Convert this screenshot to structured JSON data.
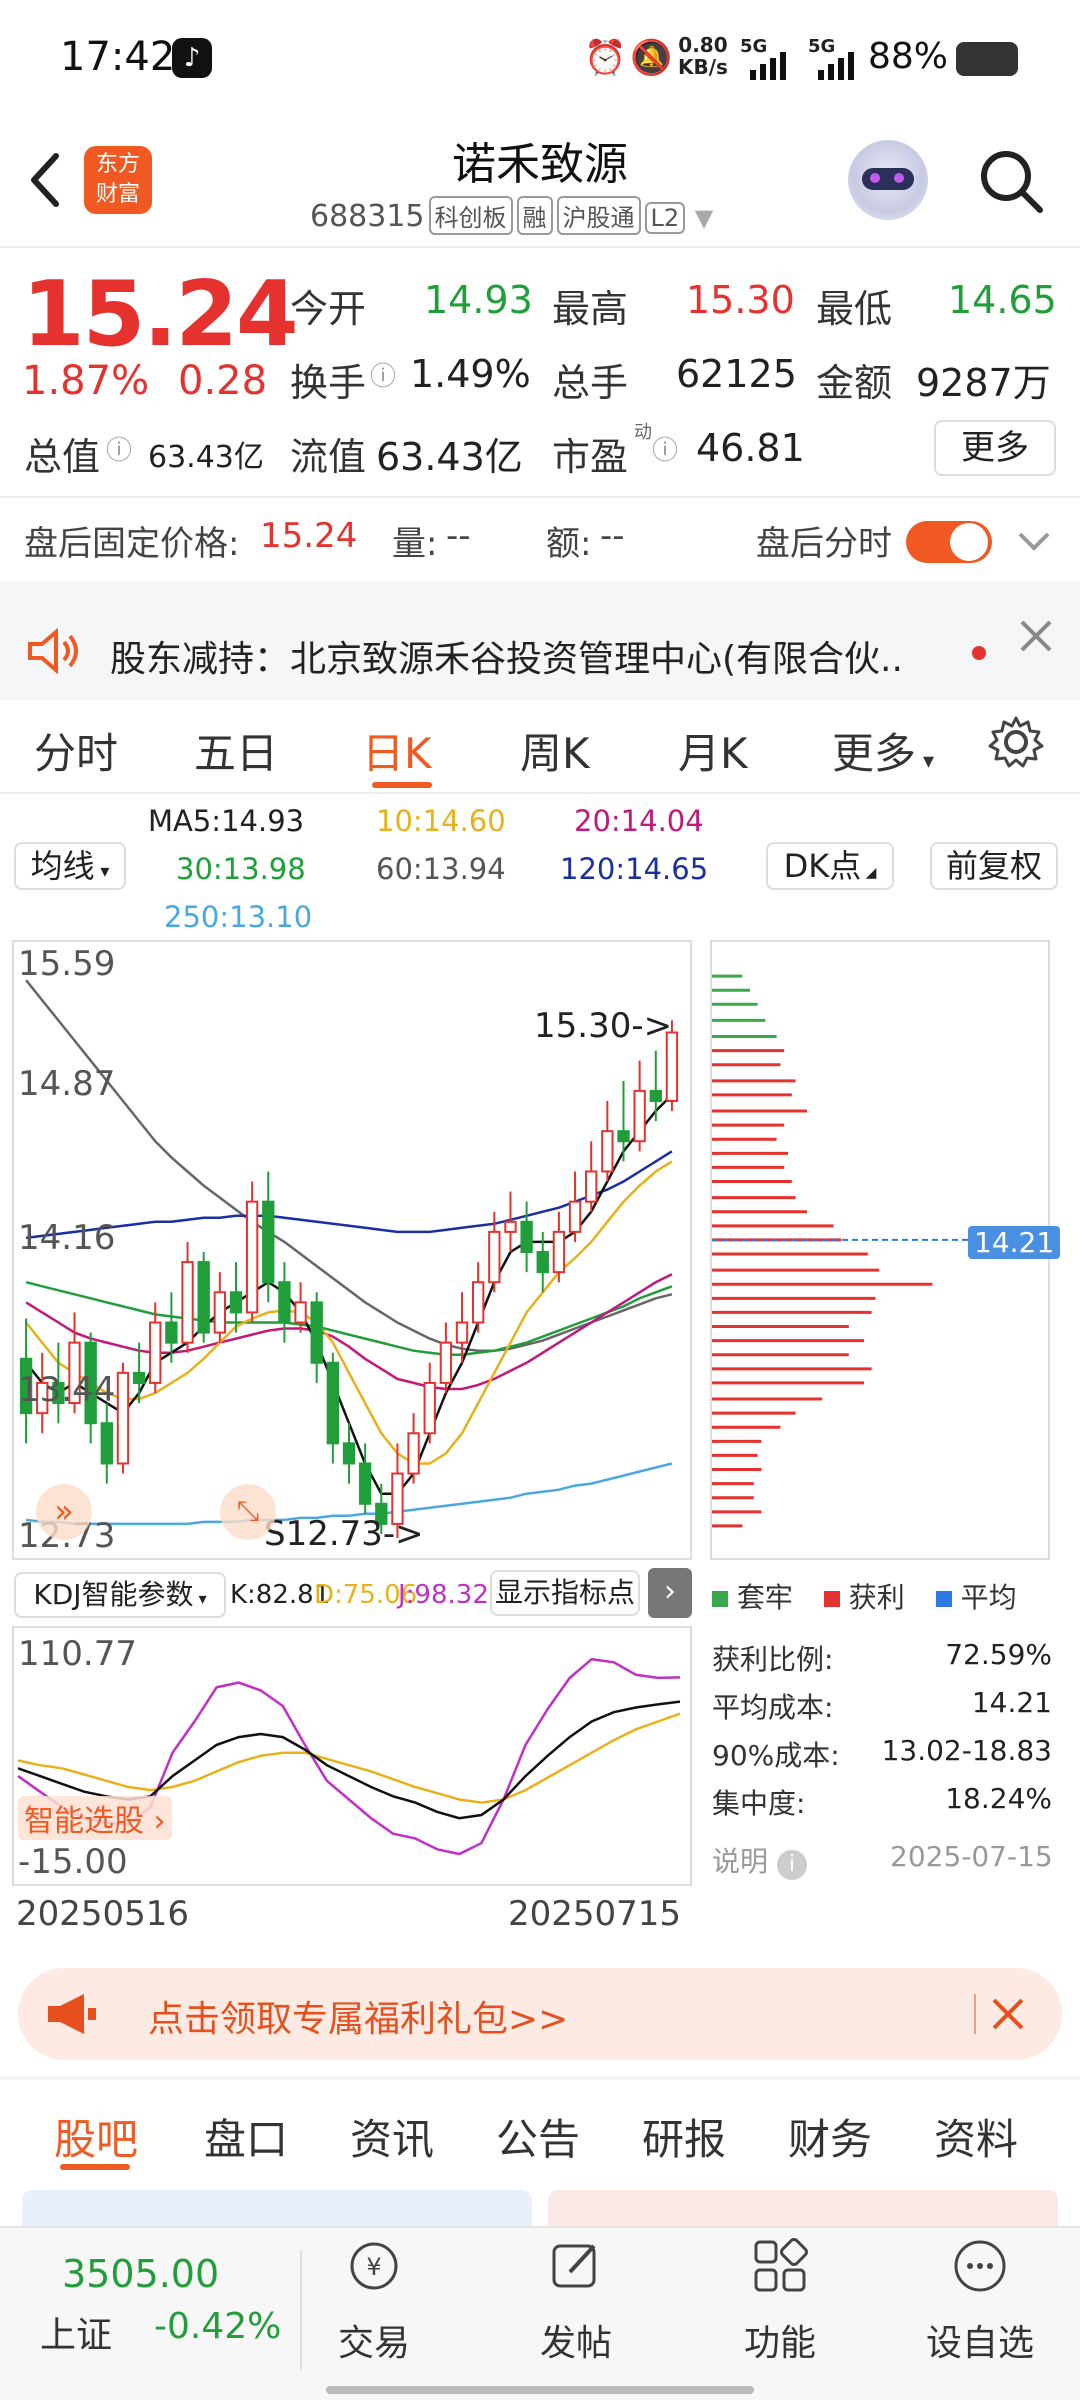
{
  "status_bar": {
    "time": "17:42",
    "speed": "0.80",
    "speed_unit": "KB/s",
    "sim1": "5G",
    "sim2": "5G",
    "battery": "88%"
  },
  "header": {
    "logo_text_1": "东方",
    "logo_text_2": "财富",
    "name": "诺禾致源",
    "code": "688315",
    "tags": [
      "科创板",
      "融",
      "沪股通",
      "L2"
    ]
  },
  "quote": {
    "price": "15.24",
    "change_pct": "1.87%",
    "change_amt": "0.28",
    "fields": [
      {
        "label": "今开",
        "value": "14.93",
        "color": "#1f9e3a"
      },
      {
        "label": "最高",
        "value": "15.30",
        "color": "#e5322e"
      },
      {
        "label": "最低",
        "value": "14.65",
        "color": "#1f9e3a"
      },
      {
        "label": "换手",
        "value": "1.49%",
        "color": "#222222"
      },
      {
        "label": "总手",
        "value": "62125",
        "color": "#222222"
      },
      {
        "label": "金额",
        "value": "9287万",
        "color": "#222222"
      },
      {
        "label": "总值",
        "value": "63.43亿",
        "color": "#222222"
      },
      {
        "label": "流值",
        "value": "63.43亿",
        "color": "#222222"
      },
      {
        "label": "市盈",
        "value": "46.81",
        "color": "#222222"
      }
    ],
    "pe_superscript": "动",
    "more_label": "更多"
  },
  "after_hours": {
    "fixed_price_label": "盘后固定价格:",
    "fixed_price": "15.24",
    "volume_label": "量:",
    "volume": "--",
    "amount_label": "额:",
    "amount": "--",
    "intraday_label": "盘后分时",
    "toggle_on": true
  },
  "news": {
    "text": "股东减持：北京致源禾谷投资管理中心(有限合伙.."
  },
  "chart_tabs": [
    "分时",
    "五日",
    "日K",
    "周K",
    "月K",
    "更多"
  ],
  "chart_tab_active": "日K",
  "ma": {
    "selector_label": "均线",
    "items": [
      {
        "label": "MA5:14.93",
        "color": "#222222"
      },
      {
        "label": "10:14.60",
        "color": "#e8b11a"
      },
      {
        "label": "20:14.04",
        "color": "#c2187a"
      },
      {
        "label": "30:13.98",
        "color": "#1f9e3a"
      },
      {
        "label": "60:13.94",
        "color": "#555555"
      },
      {
        "label": "120:14.65",
        "color": "#1a2fa0"
      },
      {
        "label": "250:13.10",
        "color": "#4aa8e0"
      }
    ],
    "dk_label": "DK点",
    "fq_label": "前复权"
  },
  "chart_data": {
    "type": "candlestick",
    "y_axis_labels": [
      "15.59",
      "14.87",
      "14.16",
      "13.44",
      "12.73"
    ],
    "x_labels": [
      "20250516",
      "20250715"
    ],
    "ylim": [
      12.73,
      15.59
    ],
    "annotations": {
      "high": "15.30->",
      "low": "S12.73->",
      "cost_tag": "14.21"
    },
    "candles": [
      [
        13.62,
        13.35,
        13.82,
        13.2
      ],
      [
        13.35,
        13.5,
        13.65,
        13.25
      ],
      [
        13.5,
        13.4,
        13.7,
        13.3
      ],
      [
        13.4,
        13.7,
        13.85,
        13.35
      ],
      [
        13.7,
        13.3,
        13.75,
        13.2
      ],
      [
        13.3,
        13.1,
        13.4,
        13.0
      ],
      [
        13.1,
        13.55,
        13.6,
        13.05
      ],
      [
        13.55,
        13.5,
        13.7,
        13.4
      ],
      [
        13.5,
        13.8,
        13.9,
        13.45
      ],
      [
        13.8,
        13.7,
        13.95,
        13.6
      ],
      [
        13.7,
        14.1,
        14.2,
        13.65
      ],
      [
        14.1,
        13.75,
        14.15,
        13.7
      ],
      [
        13.75,
        13.95,
        14.05,
        13.7
      ],
      [
        13.95,
        13.85,
        14.1,
        13.75
      ],
      [
        13.85,
        14.4,
        14.5,
        13.8
      ],
      [
        14.4,
        14.0,
        14.55,
        13.9
      ],
      [
        14.0,
        13.8,
        14.1,
        13.7
      ],
      [
        13.8,
        13.9,
        14.0,
        13.75
      ],
      [
        13.9,
        13.6,
        13.95,
        13.5
      ],
      [
        13.6,
        13.2,
        13.65,
        13.1
      ],
      [
        13.2,
        13.1,
        13.3,
        13.0
      ],
      [
        13.1,
        12.9,
        13.2,
        12.85
      ],
      [
        12.9,
        12.8,
        13.0,
        12.75
      ],
      [
        12.8,
        13.05,
        13.2,
        12.73
      ],
      [
        13.05,
        13.25,
        13.35,
        13.0
      ],
      [
        13.25,
        13.5,
        13.6,
        13.2
      ],
      [
        13.5,
        13.7,
        13.8,
        13.45
      ],
      [
        13.7,
        13.8,
        13.95,
        13.6
      ],
      [
        13.8,
        14.0,
        14.1,
        13.75
      ],
      [
        14.0,
        14.25,
        14.35,
        13.95
      ],
      [
        14.25,
        14.3,
        14.45,
        14.15
      ],
      [
        14.3,
        14.15,
        14.4,
        14.05
      ],
      [
        14.15,
        14.05,
        14.25,
        13.95
      ],
      [
        14.05,
        14.25,
        14.35,
        14.0
      ],
      [
        14.25,
        14.4,
        14.55,
        14.2
      ],
      [
        14.4,
        14.55,
        14.7,
        14.35
      ],
      [
        14.55,
        14.75,
        14.9,
        14.5
      ],
      [
        14.75,
        14.7,
        15.0,
        14.6
      ],
      [
        14.7,
        14.95,
        15.1,
        14.65
      ],
      [
        14.95,
        14.9,
        15.15,
        14.8
      ],
      [
        14.9,
        15.24,
        15.3,
        14.85
      ]
    ],
    "ma5": [
      13.6,
      13.5,
      13.45,
      13.5,
      13.45,
      13.4,
      13.35,
      13.45,
      13.6,
      13.65,
      13.7,
      13.78,
      13.85,
      13.9,
      13.95,
      14.0,
      13.95,
      13.85,
      13.7,
      13.5,
      13.3,
      13.1,
      12.95,
      12.95,
      13.05,
      13.25,
      13.45,
      13.6,
      13.8,
      14.0,
      14.15,
      14.2,
      14.2,
      14.2,
      14.25,
      14.35,
      14.5,
      14.65,
      14.75,
      14.85,
      14.93
    ],
    "ma10": [
      13.8,
      13.7,
      13.6,
      13.55,
      13.5,
      13.45,
      13.42,
      13.42,
      13.45,
      13.5,
      13.55,
      13.62,
      13.7,
      13.78,
      13.82,
      13.85,
      13.86,
      13.85,
      13.8,
      13.7,
      13.55,
      13.4,
      13.25,
      13.15,
      13.1,
      13.1,
      13.15,
      13.25,
      13.4,
      13.55,
      13.7,
      13.85,
      13.95,
      14.05,
      14.12,
      14.2,
      14.3,
      14.4,
      14.48,
      14.55,
      14.6
    ],
    "ma20": [
      13.9,
      13.85,
      13.8,
      13.75,
      13.72,
      13.7,
      13.68,
      13.66,
      13.65,
      13.65,
      13.66,
      13.68,
      13.7,
      13.72,
      13.74,
      13.76,
      13.77,
      13.77,
      13.76,
      13.73,
      13.68,
      13.62,
      13.57,
      13.52,
      13.5,
      13.48,
      13.47,
      13.47,
      13.49,
      13.52,
      13.56,
      13.6,
      13.65,
      13.7,
      13.75,
      13.8,
      13.85,
      13.9,
      13.95,
      14.0,
      14.04
    ],
    "ma30": [
      14.0,
      13.98,
      13.96,
      13.94,
      13.92,
      13.9,
      13.88,
      13.86,
      13.84,
      13.83,
      13.82,
      13.81,
      13.8,
      13.8,
      13.8,
      13.8,
      13.8,
      13.79,
      13.78,
      13.76,
      13.74,
      13.72,
      13.7,
      13.68,
      13.66,
      13.65,
      13.64,
      13.64,
      13.65,
      13.66,
      13.68,
      13.7,
      13.73,
      13.76,
      13.79,
      13.82,
      13.85,
      13.88,
      13.92,
      13.95,
      13.98
    ],
    "ma60": [
      15.5,
      15.4,
      15.3,
      15.2,
      15.1,
      15.0,
      14.9,
      14.8,
      14.7,
      14.62,
      14.55,
      14.48,
      14.42,
      14.36,
      14.3,
      14.25,
      14.2,
      14.14,
      14.08,
      14.02,
      13.96,
      13.9,
      13.85,
      13.8,
      13.76,
      13.72,
      13.69,
      13.67,
      13.66,
      13.66,
      13.67,
      13.69,
      13.71,
      13.74,
      13.77,
      13.8,
      13.83,
      13.86,
      13.89,
      13.92,
      13.94
    ],
    "ma120": [
      14.22,
      14.23,
      14.24,
      14.25,
      14.26,
      14.27,
      14.28,
      14.29,
      14.3,
      14.3,
      14.31,
      14.32,
      14.32,
      14.33,
      14.33,
      14.33,
      14.32,
      14.31,
      14.3,
      14.29,
      14.28,
      14.27,
      14.26,
      14.25,
      14.25,
      14.25,
      14.26,
      14.27,
      14.28,
      14.29,
      14.31,
      14.33,
      14.35,
      14.37,
      14.4,
      14.43,
      14.46,
      14.5,
      14.55,
      14.6,
      14.65
    ],
    "ma250": [
      12.82,
      12.81,
      12.81,
      12.8,
      12.8,
      12.8,
      12.8,
      12.8,
      12.8,
      12.8,
      12.8,
      12.81,
      12.81,
      12.81,
      12.82,
      12.82,
      12.82,
      12.83,
      12.83,
      12.84,
      12.84,
      12.85,
      12.85,
      12.86,
      12.87,
      12.88,
      12.89,
      12.9,
      12.91,
      12.92,
      12.93,
      12.95,
      12.96,
      12.97,
      12.99,
      13.0,
      13.02,
      13.04,
      13.06,
      13.08,
      13.1
    ],
    "chip_bars": [
      {
        "price": 15.52,
        "len": 40,
        "color": "#3aa84a"
      },
      {
        "price": 15.45,
        "len": 50,
        "color": "#3aa84a"
      },
      {
        "price": 15.38,
        "len": 60,
        "color": "#3aa84a"
      },
      {
        "price": 15.3,
        "len": 70,
        "color": "#3aa84a"
      },
      {
        "price": 15.22,
        "len": 85,
        "color": "#3aa84a"
      },
      {
        "price": 15.15,
        "len": 95,
        "color": "#e5322e"
      },
      {
        "price": 15.08,
        "len": 90,
        "color": "#e5322e"
      },
      {
        "price": 15.0,
        "len": 110,
        "color": "#e5322e"
      },
      {
        "price": 14.93,
        "len": 105,
        "color": "#e5322e"
      },
      {
        "price": 14.85,
        "len": 125,
        "color": "#e5322e"
      },
      {
        "price": 14.78,
        "len": 95,
        "color": "#e5322e"
      },
      {
        "price": 14.71,
        "len": 85,
        "color": "#e5322e"
      },
      {
        "price": 14.64,
        "len": 100,
        "color": "#e5322e"
      },
      {
        "price": 14.57,
        "len": 95,
        "color": "#e5322e"
      },
      {
        "price": 14.5,
        "len": 105,
        "color": "#e5322e"
      },
      {
        "price": 14.42,
        "len": 110,
        "color": "#e5322e"
      },
      {
        "price": 14.35,
        "len": 125,
        "color": "#e5322e"
      },
      {
        "price": 14.28,
        "len": 160,
        "color": "#e5322e"
      },
      {
        "price": 14.21,
        "len": 170,
        "color": "#e5322e"
      },
      {
        "price": 14.14,
        "len": 205,
        "color": "#e5322e"
      },
      {
        "price": 14.06,
        "len": 220,
        "color": "#e5322e"
      },
      {
        "price": 13.99,
        "len": 290,
        "color": "#e5322e"
      },
      {
        "price": 13.92,
        "len": 215,
        "color": "#e5322e"
      },
      {
        "price": 13.85,
        "len": 210,
        "color": "#e5322e"
      },
      {
        "price": 13.78,
        "len": 180,
        "color": "#e5322e"
      },
      {
        "price": 13.71,
        "len": 200,
        "color": "#e5322e"
      },
      {
        "price": 13.64,
        "len": 180,
        "color": "#e5322e"
      },
      {
        "price": 13.57,
        "len": 210,
        "color": "#e5322e"
      },
      {
        "price": 13.5,
        "len": 200,
        "color": "#e5322e"
      },
      {
        "price": 13.42,
        "len": 145,
        "color": "#e5322e"
      },
      {
        "price": 13.35,
        "len": 110,
        "color": "#e5322e"
      },
      {
        "price": 13.28,
        "len": 90,
        "color": "#e5322e"
      },
      {
        "price": 13.21,
        "len": 65,
        "color": "#e5322e"
      },
      {
        "price": 13.14,
        "len": 60,
        "color": "#e5322e"
      },
      {
        "price": 13.07,
        "len": 65,
        "color": "#e5322e"
      },
      {
        "price": 13.0,
        "len": 55,
        "color": "#e5322e"
      },
      {
        "price": 12.93,
        "len": 55,
        "color": "#e5322e"
      },
      {
        "price": 12.86,
        "len": 65,
        "color": "#e5322e"
      },
      {
        "price": 12.79,
        "len": 40,
        "color": "#e5322e"
      }
    ],
    "kdj": {
      "ylim": [
        -15.0,
        110.77
      ],
      "y_labels": [
        "110.77",
        "-15.00"
      ],
      "k": [
        40,
        35,
        30,
        25,
        22,
        20,
        22,
        35,
        45,
        55,
        60,
        62,
        60,
        52,
        42,
        35,
        28,
        22,
        18,
        12,
        8,
        10,
        20,
        35,
        48,
        60,
        70,
        76,
        79,
        81,
        82.81
      ],
      "d": [
        45,
        42,
        40,
        36,
        32,
        28,
        26,
        28,
        32,
        38,
        44,
        48,
        50,
        50,
        46,
        42,
        38,
        33,
        28,
        24,
        20,
        18,
        20,
        26,
        34,
        42,
        50,
        58,
        65,
        70,
        75.06
      ],
      "j": [
        35,
        25,
        15,
        8,
        5,
        4,
        15,
        50,
        70,
        92,
        95,
        90,
        80,
        55,
        32,
        20,
        8,
        -2,
        -5,
        -12,
        -15,
        -8,
        20,
        55,
        78,
        98,
        110,
        108,
        100,
        98,
        98.32
      ]
    }
  },
  "kdj_bar": {
    "selector_label": "KDJ智能参数",
    "k_label": "K:82.81",
    "d_label": "D:75.06",
    "j_label": "J:98.32",
    "show_points_label": "显示指标点",
    "smart_pick_label": "智能选股"
  },
  "chip_stats": {
    "legend": [
      {
        "label": "套牢",
        "color": "#3aa84a"
      },
      {
        "label": "获利",
        "color": "#e5322e"
      },
      {
        "label": "平均",
        "color": "#2a7be4"
      }
    ],
    "rows": [
      {
        "label": "获利比例:",
        "value": "72.59%"
      },
      {
        "label": "平均成本:",
        "value": "14.21"
      },
      {
        "label": "90%成本:",
        "value": "13.02-18.83"
      },
      {
        "label": "集中度:",
        "value": "18.24%"
      }
    ],
    "note_label": "说明",
    "date": "2025-07-15"
  },
  "promo": {
    "text": "点击领取专属福利礼包>>"
  },
  "bottom_tabs": [
    "股吧",
    "盘口",
    "资讯",
    "公告",
    "研报",
    "财务",
    "资料"
  ],
  "bottom_tab_active": "股吧",
  "tabbar": {
    "index_value": "3505.00",
    "index_name": "上证",
    "index_change": "-0.42%",
    "items": [
      "交易",
      "发帖",
      "功能",
      "设自选"
    ]
  }
}
